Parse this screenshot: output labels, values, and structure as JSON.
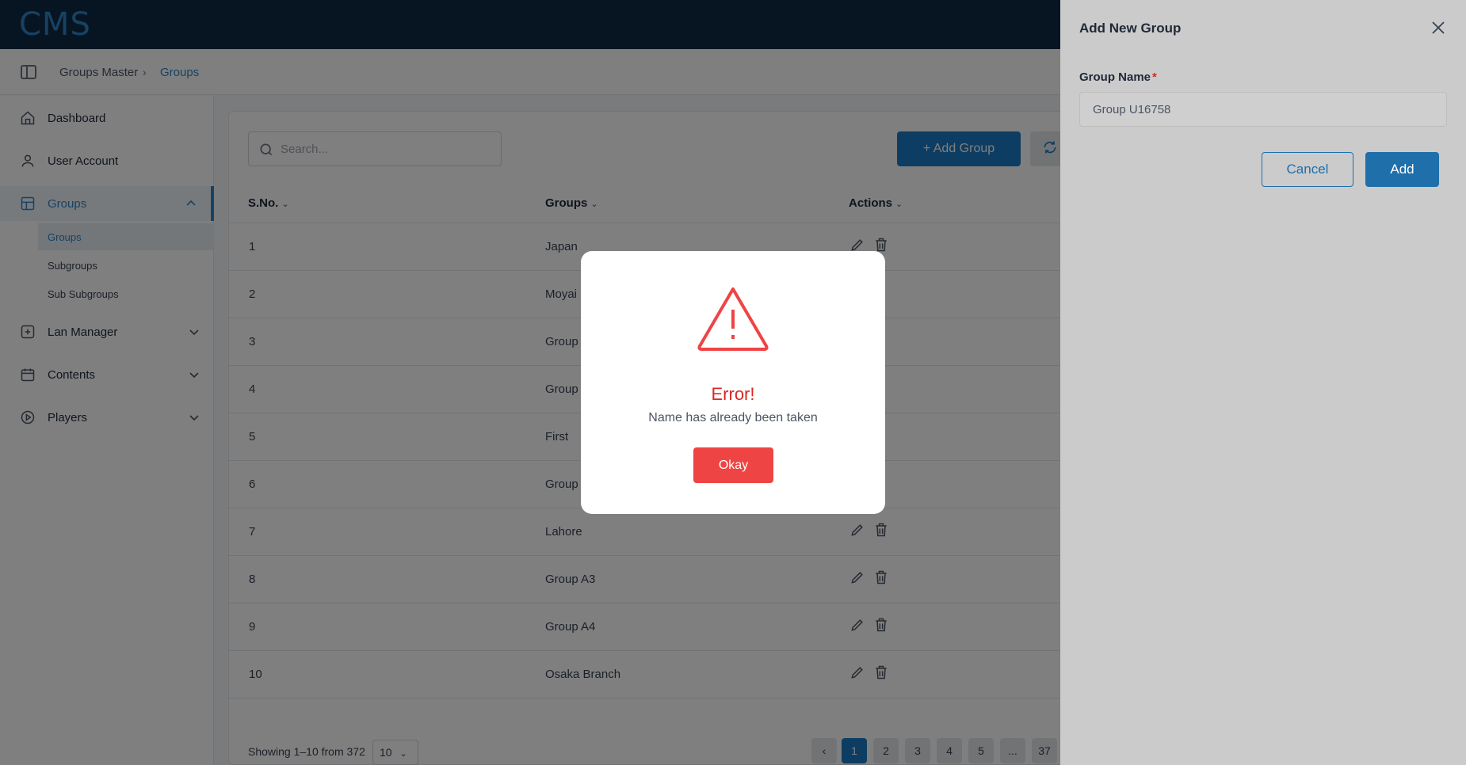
{
  "app": {
    "logo": "CMS"
  },
  "breadcrumb": {
    "parent": "Groups Master",
    "separator": "›",
    "current": "Groups"
  },
  "sidebar": {
    "items": [
      {
        "label": "Dashboard",
        "icon": "home-icon"
      },
      {
        "label": "User Account",
        "icon": "user-icon"
      },
      {
        "label": "Groups",
        "icon": "groups-icon",
        "expanded": true
      },
      {
        "label": "Lan Manager",
        "icon": "lan-icon"
      },
      {
        "label": "Contents",
        "icon": "calendar-icon"
      },
      {
        "label": "Players",
        "icon": "play-icon"
      }
    ],
    "subitems": [
      {
        "label": "Groups"
      },
      {
        "label": "Subgroups"
      },
      {
        "label": "Sub Subgroups"
      }
    ]
  },
  "toolbar": {
    "search_placeholder": "Search...",
    "add_group_label": "+ Add Group"
  },
  "table": {
    "headers": {
      "sno": "S.No.",
      "groups": "Groups",
      "actions": "Actions"
    },
    "rows": [
      {
        "sno": "1",
        "group": "Japan"
      },
      {
        "sno": "2",
        "group": "Moyai I"
      },
      {
        "sno": "3",
        "group": "Group /"
      },
      {
        "sno": "4",
        "group": "Group \\"
      },
      {
        "sno": "5",
        "group": "First"
      },
      {
        "sno": "6",
        "group": "Group /"
      },
      {
        "sno": "7",
        "group": "Lahore"
      },
      {
        "sno": "8",
        "group": "Group A3"
      },
      {
        "sno": "9",
        "group": "Group A4"
      },
      {
        "sno": "10",
        "group": "Osaka Branch"
      }
    ]
  },
  "pagination": {
    "showing": "Showing 1–10 from 372",
    "per_page": "10",
    "pages": [
      "1",
      "2",
      "3",
      "4",
      "5",
      "...",
      "37"
    ],
    "current": "1"
  },
  "drawer": {
    "title": "Add New Group",
    "field_label": "Group Name",
    "required_mark": "*",
    "field_value": "Group U16758",
    "cancel_label": "Cancel",
    "add_label": "Add"
  },
  "modal": {
    "title": "Error!",
    "message": "Name has already been taken",
    "okay_label": "Okay"
  },
  "colors": {
    "primary": "#1a7bc4",
    "topbar": "#0e2a47",
    "error": "#ef4444"
  }
}
